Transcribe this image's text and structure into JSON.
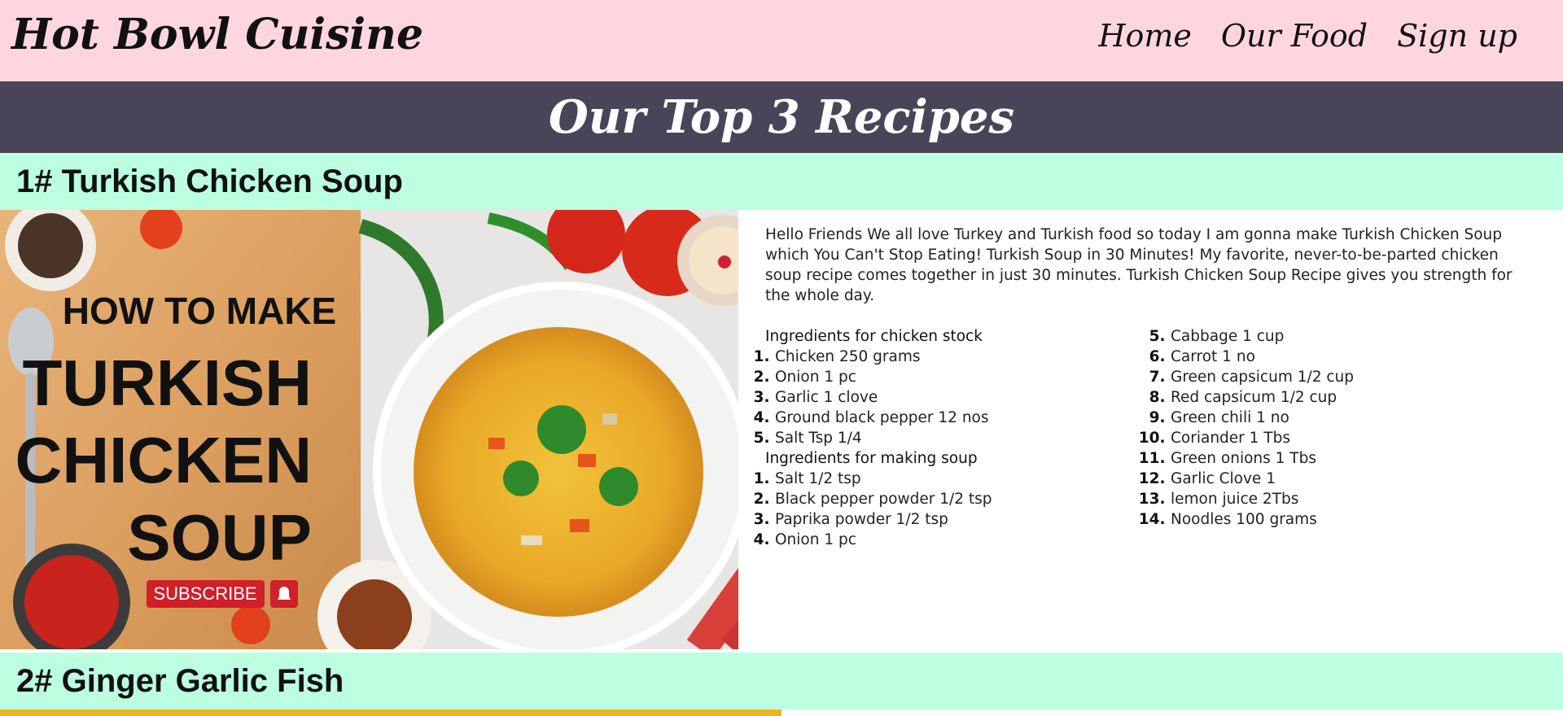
{
  "header": {
    "brand": "Hot Bowl Cuisine",
    "nav": [
      "Home",
      "Our Food",
      "Sign up"
    ]
  },
  "banner": {
    "title": "Our Top 3 Recipes"
  },
  "recipes": [
    {
      "title": "1# Turkish Chicken Soup",
      "image": {
        "lines": [
          "HOW TO MAKE",
          "TURKISH",
          "CHICKEN",
          "SOUP"
        ],
        "subscribe": "SUBSCRIBE"
      },
      "intro": "Hello Friends We all love Turkey and Turkish food so today I am gonna make Turkish Chicken Soup which You Can't Stop Eating! Turkish Soup in 30 Minutes! My favorite, never-to-be-parted chicken soup recipe comes together in just 30 minutes. Turkish Chicken Soup Recipe gives you strength for the whole day.",
      "stock_heading": "Ingredients for chicken stock",
      "stock": [
        "Chicken 250 grams",
        "Onion 1 pc",
        "Garlic 1 clove",
        "Ground black pepper 12 nos",
        "Salt Tsp 1/4"
      ],
      "soup_heading": "Ingredients for making soup",
      "soup_left": [
        "Salt 1/2 tsp",
        "Black pepper powder 1/2 tsp",
        "Paprika powder 1/2 tsp",
        "Onion 1 pc"
      ],
      "soup_right": [
        "Cabbage 1 cup",
        "Carrot 1 no",
        "Green capsicum 1/2 cup",
        "Red capsicum 1/2 cup",
        "Green chili 1 no",
        "Coriander 1 Tbs",
        "Green onions 1 Tbs",
        "Garlic Clove 1",
        "lemon juice 2Tbs",
        "Noodles 100 grams"
      ]
    },
    {
      "title": "2# Ginger Garlic Fish"
    }
  ]
}
